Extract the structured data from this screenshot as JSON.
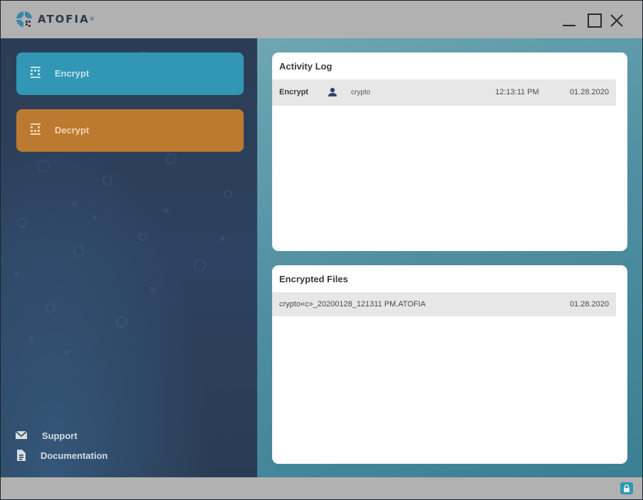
{
  "app": {
    "brand": "ATOFIA",
    "brand_mark": "®"
  },
  "sidebar": {
    "nav": [
      {
        "label": "Encrypt",
        "icon": "encrypt-icon",
        "color": "#3197b4"
      },
      {
        "label": "Decrypt",
        "icon": "decrypt-icon",
        "color": "#bc7a30"
      }
    ],
    "footer": [
      {
        "label": "Support",
        "icon": "mail-icon"
      },
      {
        "label": "Documentation",
        "icon": "document-icon"
      }
    ]
  },
  "activity_log": {
    "title": "Activity Log",
    "rows": [
      {
        "action": "Encrypt",
        "user": "crypto",
        "time": "12:13:11 PM",
        "date": "01.28.2020"
      }
    ]
  },
  "encrypted_files": {
    "title": "Encrypted Files",
    "rows": [
      {
        "filename": "crypto«c»_20200128_121311 PM.ATOFIA",
        "date": "01.28.2020"
      }
    ]
  },
  "colors": {
    "titlebar": "#b1b1b1",
    "sidebar": "#2b3d55",
    "accent_blue": "#3197b4",
    "accent_orange": "#bc7a30",
    "main_bg": "#4e8ea0"
  }
}
